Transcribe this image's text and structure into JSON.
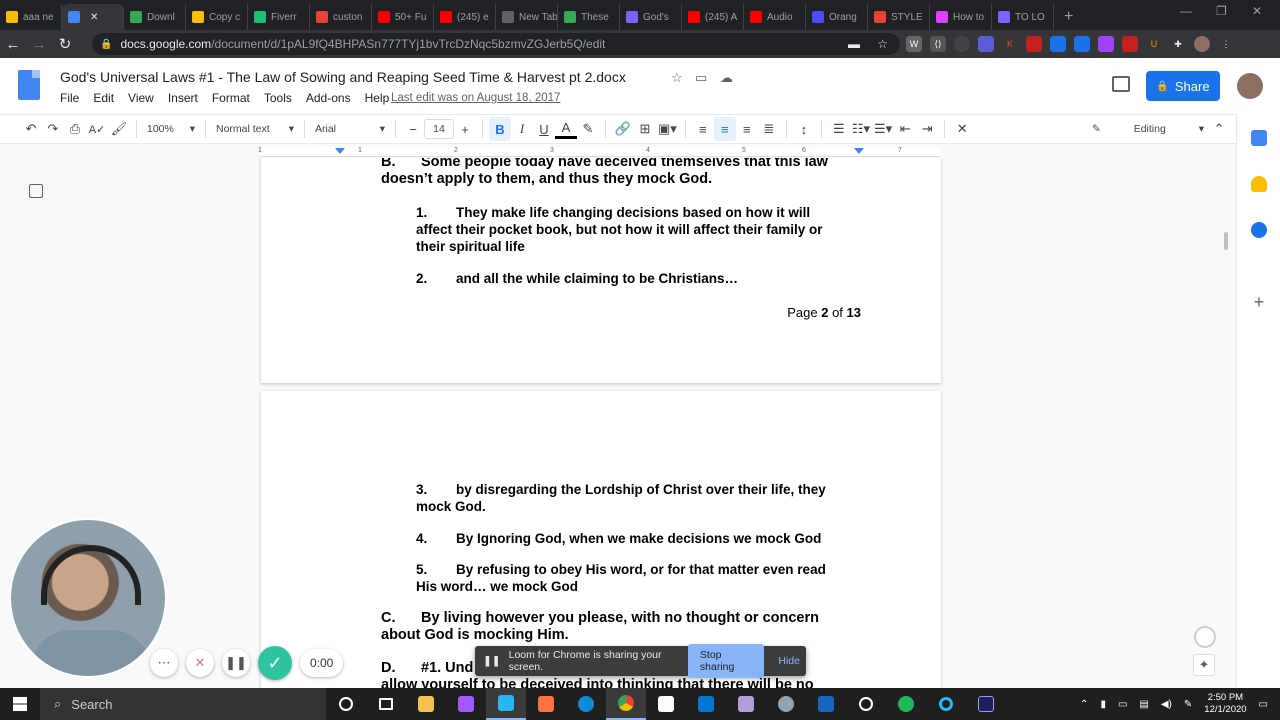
{
  "browser": {
    "tabs": [
      {
        "label": "aaa ne",
        "color": "#fbbc04"
      },
      {
        "label": "",
        "color": "#4285f4",
        "active": true
      },
      {
        "label": "Downl",
        "color": "#34a853"
      },
      {
        "label": "Copy c",
        "color": "#fbbc04"
      },
      {
        "label": "Fiverr",
        "color": "#1dbf73"
      },
      {
        "label": "custon",
        "color": "#ea4335"
      },
      {
        "label": "50+ Fu",
        "color": "#ff0000"
      },
      {
        "label": "(245) e",
        "color": "#ff0000"
      },
      {
        "label": "New Tab",
        "color": "#5f6368"
      },
      {
        "label": "These",
        "color": "#34a853"
      },
      {
        "label": "God's",
        "color": "#7b61ff"
      },
      {
        "label": "(245) A",
        "color": "#ff0000"
      },
      {
        "label": "Audio",
        "color": "#ff0000"
      },
      {
        "label": "Orang",
        "color": "#4a4aff"
      },
      {
        "label": "STYLE",
        "color": "#ea4335"
      },
      {
        "label": "How to",
        "color": "#e040fb"
      },
      {
        "label": "TO LO",
        "color": "#7b61ff"
      }
    ],
    "new_tab": "+",
    "url_host": "docs.google.com",
    "url_path": "/document/d/1pAL9fQ4BHPASn777TYj1bvTrcDzNqc5bzmvZGJerb5Q/edit"
  },
  "docs": {
    "title": "God's Universal Laws #1 - The Law of Sowing and Reaping Seed Time & Harvest pt 2.docx",
    "menu": [
      "File",
      "Edit",
      "View",
      "Insert",
      "Format",
      "Tools",
      "Add-ons",
      "Help"
    ],
    "last_edit": "Last edit was on August 18, 2017",
    "share_label": "Share"
  },
  "toolbar": {
    "zoom": "100%",
    "style": "Normal text",
    "font": "Arial",
    "font_size": "14",
    "mode": "Editing"
  },
  "ruler": {
    "marks": [
      "1",
      "1",
      "2",
      "3",
      "4",
      "5",
      "6",
      "7"
    ]
  },
  "document": {
    "page1": {
      "b_head": "B.",
      "b_line1": "Some people today have deceived themselves that this law",
      "b_line2": "doesn’t apply to them, and thus they mock God.",
      "i1_num": "1.",
      "i1_line1": "They make life changing decisions based on how it will",
      "i1_line2": "affect their pocket book, but not how it will affect their family or",
      "i1_line3": "their spiritual life",
      "i2_num": "2.",
      "i2_line1": "and all the while claiming to be Christians…",
      "footer_pre": "Page ",
      "footer_page": "2",
      "footer_mid": " of ",
      "footer_total": "13"
    },
    "page2": {
      "i3_num": "3.",
      "i3_line1": "by disregarding the Lordship of Christ over their life, they",
      "i3_line2": "mock God.",
      "i4_num": "4.",
      "i4_line1": "By Ignoring God, when we make decisions we mock God",
      "i5_num": "5.",
      "i5_line1": "By refusing to obey His word, or for that matter even read",
      "i5_line2": "His word… we mock God",
      "c_head": "C.",
      "c_line1": "By living however you please, with no thought or concern",
      "c_line2": "about God is mocking Him.",
      "d_head": "D.",
      "d_line1a": "#1. Und",
      "d_line1b": "’t",
      "d_line2": "allow yourself to be deceived into thinking that there will be no"
    }
  },
  "loom": {
    "timer": "0:00",
    "share_message": "Loom for Chrome is sharing your screen.",
    "stop_label": "Stop sharing",
    "hide_label": "Hide"
  },
  "taskbar": {
    "search_label": "Search",
    "time": "2:50 PM",
    "date": "12/1/2020"
  }
}
